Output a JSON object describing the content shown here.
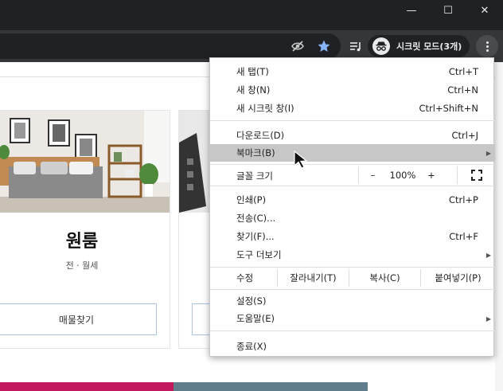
{
  "window": {
    "minimize_glyph": "—",
    "maximize_glyph": "☐",
    "close_glyph": "✕"
  },
  "toolbar": {
    "incognito_label": "시크릿 모드(3개)"
  },
  "page": {
    "card1": {
      "title": "원룸",
      "subtitle": "전 · 월세",
      "button": "매물찾기"
    }
  },
  "menu": {
    "new_tab": {
      "label": "새 탭(T)",
      "shortcut": "Ctrl+T"
    },
    "new_window": {
      "label": "새 창(N)",
      "shortcut": "Ctrl+N"
    },
    "new_incognito": {
      "label": "새 시크릿 창(I)",
      "shortcut": "Ctrl+Shift+N"
    },
    "downloads": {
      "label": "다운로드(D)",
      "shortcut": "Ctrl+J"
    },
    "bookmarks": {
      "label": "북마크(B)"
    },
    "zoom": {
      "label": "글꼴 크기",
      "minus": "–",
      "value": "100%",
      "plus": "+"
    },
    "print": {
      "label": "인쇄(P)",
      "shortcut": "Ctrl+P"
    },
    "cast": {
      "label": "전송(C)..."
    },
    "find": {
      "label": "찾기(F)...",
      "shortcut": "Ctrl+F"
    },
    "more_tools": {
      "label": "도구 더보기"
    },
    "edit": {
      "label": "수정",
      "cut": "잘라내기(T)",
      "copy": "복사(C)",
      "paste": "붙여넣기(P)"
    },
    "settings": {
      "label": "설정(S)"
    },
    "help": {
      "label": "도움말(E)"
    },
    "exit": {
      "label": "종료(X)"
    }
  },
  "colors": {
    "titlebar": "#202124",
    "toolbar": "#35363a",
    "highlight": "#c7c7c7",
    "star": "#8ab4f8",
    "banner": "#c2185b"
  }
}
